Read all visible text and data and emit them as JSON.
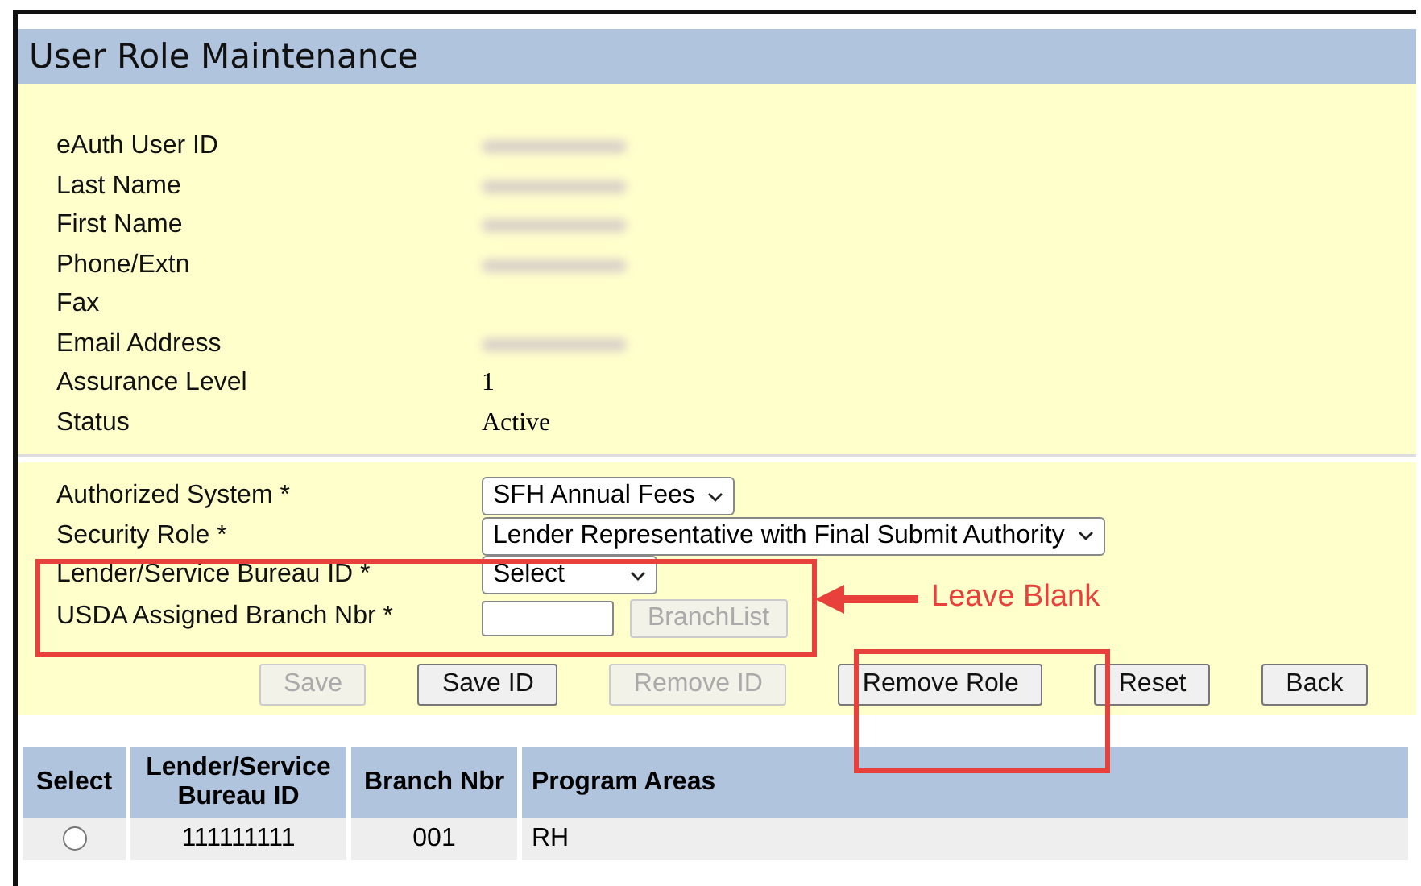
{
  "window": {
    "title": "User Role Maintenance"
  },
  "info": [
    {
      "label": "eAuth User ID",
      "redacted": true
    },
    {
      "label": "Last Name",
      "redacted": true
    },
    {
      "label": "First Name",
      "redacted": true
    },
    {
      "label": "Phone/Extn",
      "redacted": true
    },
    {
      "label": "Fax",
      "redacted": false
    },
    {
      "label": "Email Address",
      "redacted": true
    },
    {
      "label": "Assurance Level",
      "redacted": false,
      "value": "1"
    },
    {
      "label": "Status",
      "redacted": false,
      "value": "Active"
    }
  ],
  "form": [
    {
      "label": "Authorized System *",
      "kind": "select",
      "value": "SFH Annual Fees"
    },
    {
      "label": "Security Role *",
      "kind": "select",
      "value": "Lender Representative with Final Submit Authority"
    },
    {
      "label": "Lender/Service Bureau ID *",
      "kind": "select",
      "value": "Select"
    },
    {
      "label": "USDA Assigned Branch Nbr *",
      "kind": "input",
      "button": {
        "label": "BranchList",
        "disabled": true
      }
    }
  ],
  "buttons": [
    {
      "label": "Save",
      "disabled": true
    },
    {
      "label": "Save ID",
      "disabled": false
    },
    {
      "label": "Remove ID",
      "disabled": true
    },
    {
      "label": "Remove Role",
      "disabled": false
    },
    {
      "label": "Reset",
      "disabled": false
    },
    {
      "label": "Back",
      "disabled": false
    }
  ],
  "table": {
    "columns": [
      "Select",
      "Lender/Service Bureau ID",
      "Branch Nbr",
      "Program Areas"
    ],
    "rows": [
      {
        "selected": false,
        "lender_service_bureau_id": "111111111",
        "branch_nbr": "001",
        "program_areas": "RH"
      }
    ]
  },
  "annotation": {
    "text": "Leave Blank"
  }
}
